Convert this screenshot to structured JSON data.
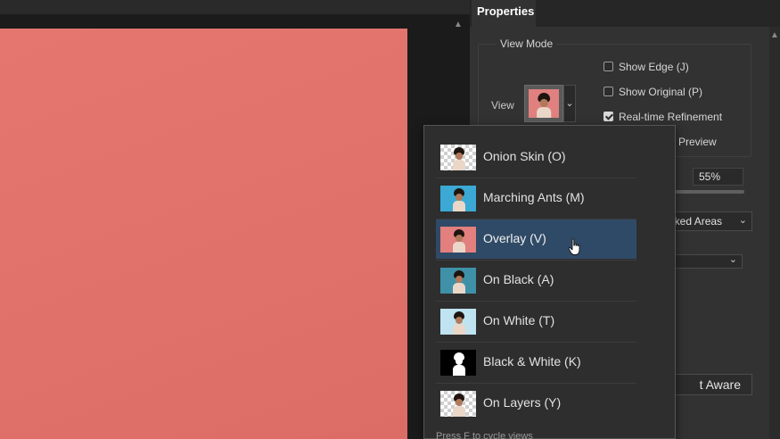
{
  "panel": {
    "tab_label": "Properties",
    "view_mode_legend": "View Mode",
    "view_label": "View",
    "options": [
      {
        "label": "Show Edge (J)",
        "checked": false
      },
      {
        "label": "Show Original (P)",
        "checked": false
      },
      {
        "label": "Real-time Refinement",
        "checked": true
      }
    ],
    "preview_label": "Preview",
    "opacity_value": "55%",
    "masked_areas_value": "asked Areas",
    "aware_button_label": "t Aware"
  },
  "view_menu": {
    "items": [
      {
        "label": "Onion Skin (O)",
        "thumb": "checker",
        "selected": false
      },
      {
        "label": "Marching Ants (M)",
        "thumb": "blue",
        "selected": false
      },
      {
        "label": "Overlay (V)",
        "thumb": "pink",
        "selected": true
      },
      {
        "label": "On Black (A)",
        "thumb": "teal",
        "selected": false
      },
      {
        "label": "On White (T)",
        "thumb": "light-blue",
        "selected": false
      },
      {
        "label": "Black & White (K)",
        "thumb": "black-white",
        "selected": false
      },
      {
        "label": "On Layers (Y)",
        "thumb": "checker",
        "selected": false
      }
    ],
    "footer_hint": "Press F to cycle views"
  },
  "colors": {
    "canvas": "#e0706a",
    "selected_item": "#2f4a66",
    "panel_bg": "#323232"
  },
  "icons": {
    "dropdown": "chevron-down-icon",
    "scroll_up": "chevron-up-icon",
    "cursor": "hand-pointer-icon"
  }
}
